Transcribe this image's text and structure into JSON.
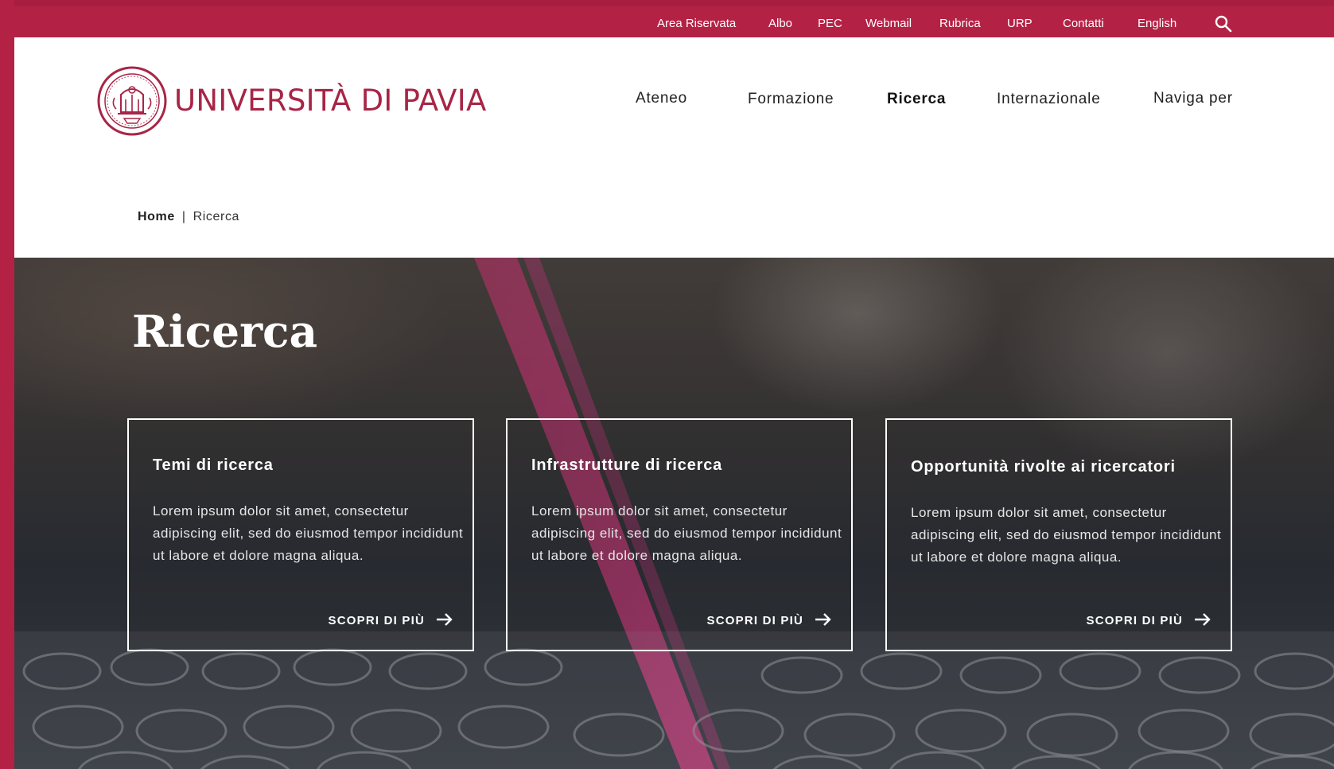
{
  "utility_nav": {
    "items": [
      "Area Riservata",
      "Albo",
      "PEC",
      "Webmail",
      "Rubrica",
      "URP",
      "Contatti",
      "English"
    ],
    "search_icon": "search-icon"
  },
  "brand": {
    "name": "UNIVERSITÀ DI PAVIA",
    "color": "#a72546",
    "logo_icon": "university-seal-icon"
  },
  "main_nav": {
    "items": [
      "Ateneo",
      "Formazione",
      "Ricerca",
      "Internazionale",
      "Naviga per"
    ],
    "active": "Ricerca"
  },
  "breadcrumb": {
    "home": "Home",
    "separator": "|",
    "current": "Ricerca"
  },
  "hero": {
    "title": "Ricerca"
  },
  "cards": [
    {
      "title": "Temi di ricerca",
      "text": "Lorem ipsum dolor sit amet, consectetur adipiscing elit, sed do eiusmod tempor incididunt ut labore et dolore magna aliqua.",
      "link": "SCOPRI DI PIÙ"
    },
    {
      "title": "Infrastrutture di ricerca",
      "text": "Lorem ipsum dolor sit amet, consectetur adipiscing elit, sed do eiusmod tempor incididunt ut labore et dolore magna aliqua.",
      "link": "SCOPRI DI PIÙ"
    },
    {
      "title": "Opportunità rivolte ai ricercatori",
      "text": "Lorem ipsum dolor sit amet, consectetur adipiscing elit, sed do eiusmod tempor incididunt ut labore et dolore magna aliqua.",
      "link": "SCOPRI DI PIÙ"
    }
  ],
  "colors": {
    "brand_red": "#b32245",
    "header_bg": "#ffffff",
    "text_dark": "#222222"
  }
}
